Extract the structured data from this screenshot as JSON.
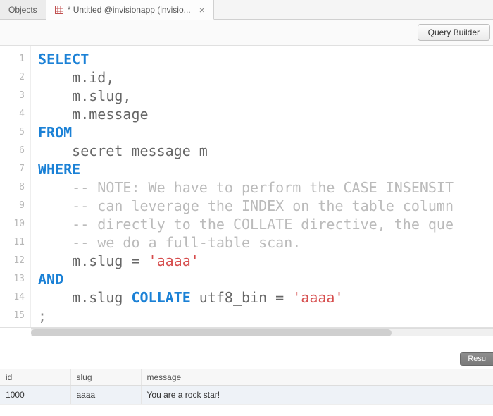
{
  "tabs": {
    "objects": "Objects",
    "active": "* Untitled @invisionapp (invisio..."
  },
  "toolbar": {
    "query_builder": "Query Builder"
  },
  "code": {
    "lines": [
      "1",
      "2",
      "3",
      "4",
      "5",
      "6",
      "7",
      "8",
      "9",
      "10",
      "11",
      "12",
      "13",
      "14",
      "15"
    ],
    "kw_select": "SELECT",
    "l2": "m.id,",
    "l3": "m.slug,",
    "l4": "m.message",
    "kw_from": "FROM",
    "l6": "secret_message m",
    "kw_where": "WHERE",
    "c8": "-- NOTE: We have to perform the CASE INSENSIT",
    "c9": "-- can leverage the INDEX on the table column",
    "c10": "-- directly to the COLLATE directive, the que",
    "c11": "-- we do a full-table scan.",
    "l12a": "m.slug = ",
    "l12b": "'aaaa'",
    "kw_and": "AND",
    "l14a": "m.slug ",
    "kw_collate": "COLLATE",
    "l14b": " utf8_bin = ",
    "l14c": "'aaaa'",
    "l15": ";"
  },
  "results": {
    "tab_label": "Resu",
    "columns": [
      "id",
      "slug",
      "message"
    ],
    "rows": [
      {
        "id": "1000",
        "slug": "aaaa",
        "message": "You are a rock star!"
      }
    ]
  }
}
